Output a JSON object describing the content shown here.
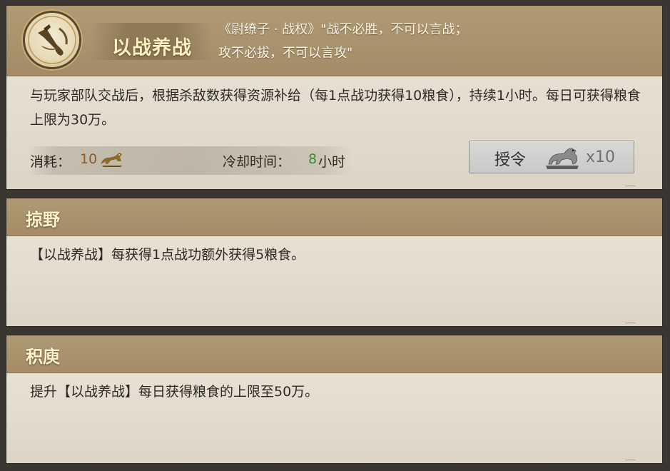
{
  "skill": {
    "title": "以战养战",
    "icon": "horn-emblem-icon",
    "quote_line1": "《尉缭子 · 战权》\"战不必胜，不可以言战；",
    "quote_line2": "攻不必拔，不可以言攻\"",
    "description": "与玩家部队交战后，根据杀敌数获得资源补给（每1点战功获得10粮食），持续1小时。每日可获得粮食上限为30万。",
    "cost_label": "消耗：",
    "cost_value": "10",
    "cost_icon": "bronze-horse-icon",
    "cooldown_label": "冷却时间：",
    "cooldown_value": "8",
    "cooldown_unit": "小时",
    "button_label": "授令",
    "button_icon": "silver-tiger-token-icon",
    "button_qty": "x10"
  },
  "upgrades": [
    {
      "title": "掠野",
      "description": "【以战养战】每获得1点战功额外获得5粮食。"
    },
    {
      "title": "积庾",
      "description": "提升【以战养战】每日获得粮食的上限至50万。"
    }
  ],
  "colors": {
    "header": "#a38c67",
    "panel": "#e6e0d3",
    "cost_value": "#8a5a28",
    "cooldown_value": "#3d8b35",
    "title_text": "#fff3c2"
  }
}
